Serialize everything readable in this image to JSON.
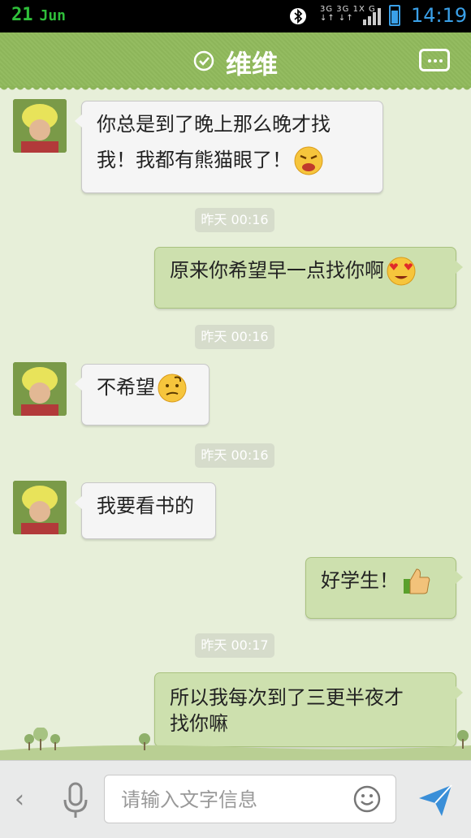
{
  "status_bar": {
    "day": "21",
    "month": "Jun",
    "network": [
      "3G 3G 1X G",
      "↓↑ ↓↑"
    ],
    "time": "14:19",
    "icons": [
      "bluetooth-icon",
      "signal-icon",
      "battery-icon"
    ]
  },
  "header": {
    "title": "维维",
    "icons": [
      "verified-check-icon",
      "more-menu-icon"
    ]
  },
  "messages": [
    {
      "side": "in",
      "lines": [
        "你总是到了晚上那么晚才找",
        "我！我都有熊猫眼了！"
      ],
      "emoji": "angry-emoji"
    },
    {
      "timestamp": "昨天 00:16"
    },
    {
      "side": "out",
      "lines": [
        "原来你希望早一点找你啊"
      ],
      "emoji": "heart-eyes-emoji"
    },
    {
      "timestamp": "昨天 00:16"
    },
    {
      "side": "in",
      "lines": [
        "不希望"
      ],
      "emoji": "confused-emoji"
    },
    {
      "timestamp": "昨天 00:16"
    },
    {
      "side": "in",
      "lines": [
        "我要看书的"
      ]
    },
    {
      "side": "out",
      "lines": [
        "好学生！"
      ],
      "emoji": "thumbs-up-emoji"
    },
    {
      "timestamp": "昨天 00:17"
    },
    {
      "side": "out",
      "lines": [
        "所以我每次到了三更半夜才",
        "找你嘛"
      ]
    }
  ],
  "input_bar": {
    "placeholder": "请输入文字信息",
    "icons": [
      "back-chevron-icon",
      "microphone-icon",
      "smiley-icon",
      "send-icon"
    ]
  },
  "colors": {
    "header_green": "#8db55a",
    "out_bubble": "#cde0ae",
    "background": "#e7efd9",
    "accent_blue": "#3aa0e8"
  }
}
